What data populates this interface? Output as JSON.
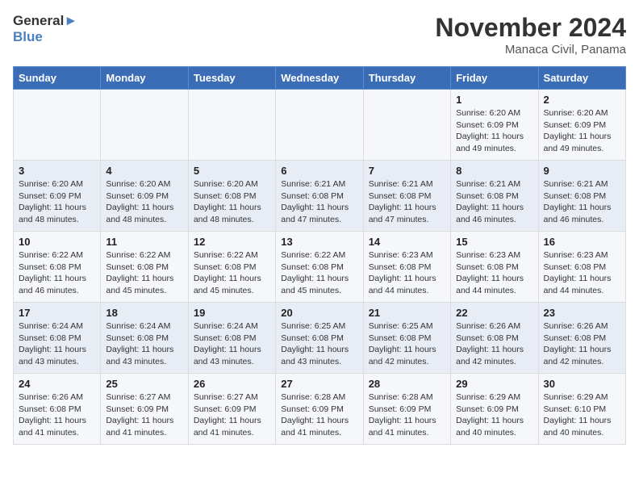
{
  "logo": {
    "text_general": "General",
    "text_blue": "Blue"
  },
  "header": {
    "month": "November 2024",
    "location": "Manaca Civil, Panama"
  },
  "weekdays": [
    "Sunday",
    "Monday",
    "Tuesday",
    "Wednesday",
    "Thursday",
    "Friday",
    "Saturday"
  ],
  "weeks": [
    [
      {
        "day": "",
        "info": ""
      },
      {
        "day": "",
        "info": ""
      },
      {
        "day": "",
        "info": ""
      },
      {
        "day": "",
        "info": ""
      },
      {
        "day": "",
        "info": ""
      },
      {
        "day": "1",
        "info": "Sunrise: 6:20 AM\nSunset: 6:09 PM\nDaylight: 11 hours and 49 minutes."
      },
      {
        "day": "2",
        "info": "Sunrise: 6:20 AM\nSunset: 6:09 PM\nDaylight: 11 hours and 49 minutes."
      }
    ],
    [
      {
        "day": "3",
        "info": "Sunrise: 6:20 AM\nSunset: 6:09 PM\nDaylight: 11 hours and 48 minutes."
      },
      {
        "day": "4",
        "info": "Sunrise: 6:20 AM\nSunset: 6:09 PM\nDaylight: 11 hours and 48 minutes."
      },
      {
        "day": "5",
        "info": "Sunrise: 6:20 AM\nSunset: 6:08 PM\nDaylight: 11 hours and 48 minutes."
      },
      {
        "day": "6",
        "info": "Sunrise: 6:21 AM\nSunset: 6:08 PM\nDaylight: 11 hours and 47 minutes."
      },
      {
        "day": "7",
        "info": "Sunrise: 6:21 AM\nSunset: 6:08 PM\nDaylight: 11 hours and 47 minutes."
      },
      {
        "day": "8",
        "info": "Sunrise: 6:21 AM\nSunset: 6:08 PM\nDaylight: 11 hours and 46 minutes."
      },
      {
        "day": "9",
        "info": "Sunrise: 6:21 AM\nSunset: 6:08 PM\nDaylight: 11 hours and 46 minutes."
      }
    ],
    [
      {
        "day": "10",
        "info": "Sunrise: 6:22 AM\nSunset: 6:08 PM\nDaylight: 11 hours and 46 minutes."
      },
      {
        "day": "11",
        "info": "Sunrise: 6:22 AM\nSunset: 6:08 PM\nDaylight: 11 hours and 45 minutes."
      },
      {
        "day": "12",
        "info": "Sunrise: 6:22 AM\nSunset: 6:08 PM\nDaylight: 11 hours and 45 minutes."
      },
      {
        "day": "13",
        "info": "Sunrise: 6:22 AM\nSunset: 6:08 PM\nDaylight: 11 hours and 45 minutes."
      },
      {
        "day": "14",
        "info": "Sunrise: 6:23 AM\nSunset: 6:08 PM\nDaylight: 11 hours and 44 minutes."
      },
      {
        "day": "15",
        "info": "Sunrise: 6:23 AM\nSunset: 6:08 PM\nDaylight: 11 hours and 44 minutes."
      },
      {
        "day": "16",
        "info": "Sunrise: 6:23 AM\nSunset: 6:08 PM\nDaylight: 11 hours and 44 minutes."
      }
    ],
    [
      {
        "day": "17",
        "info": "Sunrise: 6:24 AM\nSunset: 6:08 PM\nDaylight: 11 hours and 43 minutes."
      },
      {
        "day": "18",
        "info": "Sunrise: 6:24 AM\nSunset: 6:08 PM\nDaylight: 11 hours and 43 minutes."
      },
      {
        "day": "19",
        "info": "Sunrise: 6:24 AM\nSunset: 6:08 PM\nDaylight: 11 hours and 43 minutes."
      },
      {
        "day": "20",
        "info": "Sunrise: 6:25 AM\nSunset: 6:08 PM\nDaylight: 11 hours and 43 minutes."
      },
      {
        "day": "21",
        "info": "Sunrise: 6:25 AM\nSunset: 6:08 PM\nDaylight: 11 hours and 42 minutes."
      },
      {
        "day": "22",
        "info": "Sunrise: 6:26 AM\nSunset: 6:08 PM\nDaylight: 11 hours and 42 minutes."
      },
      {
        "day": "23",
        "info": "Sunrise: 6:26 AM\nSunset: 6:08 PM\nDaylight: 11 hours and 42 minutes."
      }
    ],
    [
      {
        "day": "24",
        "info": "Sunrise: 6:26 AM\nSunset: 6:08 PM\nDaylight: 11 hours and 41 minutes."
      },
      {
        "day": "25",
        "info": "Sunrise: 6:27 AM\nSunset: 6:09 PM\nDaylight: 11 hours and 41 minutes."
      },
      {
        "day": "26",
        "info": "Sunrise: 6:27 AM\nSunset: 6:09 PM\nDaylight: 11 hours and 41 minutes."
      },
      {
        "day": "27",
        "info": "Sunrise: 6:28 AM\nSunset: 6:09 PM\nDaylight: 11 hours and 41 minutes."
      },
      {
        "day": "28",
        "info": "Sunrise: 6:28 AM\nSunset: 6:09 PM\nDaylight: 11 hours and 41 minutes."
      },
      {
        "day": "29",
        "info": "Sunrise: 6:29 AM\nSunset: 6:09 PM\nDaylight: 11 hours and 40 minutes."
      },
      {
        "day": "30",
        "info": "Sunrise: 6:29 AM\nSunset: 6:10 PM\nDaylight: 11 hours and 40 minutes."
      }
    ]
  ]
}
